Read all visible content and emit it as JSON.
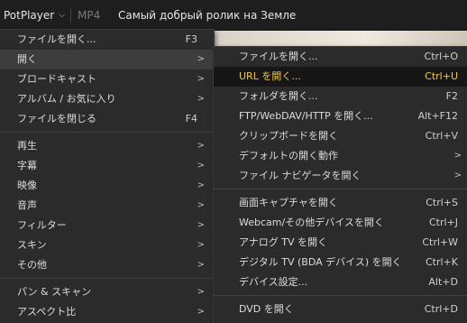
{
  "titlebar": {
    "app_name": "PotPlayer",
    "format": "MP4",
    "video_title": "Самый добрый ролик на Земле"
  },
  "main_menu": {
    "items": [
      {
        "label": "ファイルを開く...",
        "shortcut": "F3"
      },
      {
        "label": "開く",
        "arrow": ">"
      },
      {
        "label": "ブロードキャスト",
        "arrow": ">"
      },
      {
        "label": "アルバム / お気に入り",
        "arrow": ">"
      },
      {
        "label": "ファイルを閉じる",
        "shortcut": "F4"
      },
      {
        "label": "再生",
        "arrow": ">"
      },
      {
        "label": "字幕",
        "arrow": ">"
      },
      {
        "label": "映像",
        "arrow": ">"
      },
      {
        "label": "音声",
        "arrow": ">"
      },
      {
        "label": "フィルター",
        "arrow": ">"
      },
      {
        "label": "スキン",
        "arrow": ">"
      },
      {
        "label": "その他",
        "arrow": ">"
      },
      {
        "label": "パン & スキャン",
        "arrow": ">"
      },
      {
        "label": "アスペクト比",
        "arrow": ">"
      }
    ]
  },
  "submenu": {
    "items": [
      {
        "label": "ファイルを開く...",
        "shortcut": "Ctrl+O"
      },
      {
        "label": "URL を開く...",
        "shortcut": "Ctrl+U"
      },
      {
        "label": "フォルダを開く...",
        "shortcut": "F2"
      },
      {
        "label": "FTP/WebDAV/HTTP を開く...",
        "shortcut": "Alt+F12"
      },
      {
        "label": "クリップボードを開く",
        "shortcut": "Ctrl+V"
      },
      {
        "label": "デフォルトの開く動作",
        "arrow": ">"
      },
      {
        "label": "ファイル ナビゲータを開く",
        "arrow": ">"
      },
      {
        "label": "画面キャプチャを開く",
        "shortcut": "Ctrl+S"
      },
      {
        "label": "Webcam/その他デバイスを開く",
        "shortcut": "Ctrl+J"
      },
      {
        "label": "アナログ TV を開く",
        "shortcut": "Ctrl+W"
      },
      {
        "label": "デジタル TV (BDA デバイス) を開く",
        "shortcut": "Ctrl+K"
      },
      {
        "label": "デバイス設定...",
        "shortcut": "Alt+D"
      },
      {
        "label": "DVD を開く",
        "shortcut": "Ctrl+D"
      }
    ]
  },
  "colors": {
    "menu_bg": "#2b2b2b",
    "highlight_text": "#f0c84a",
    "titlebar_bg": "#1e1e1e"
  }
}
